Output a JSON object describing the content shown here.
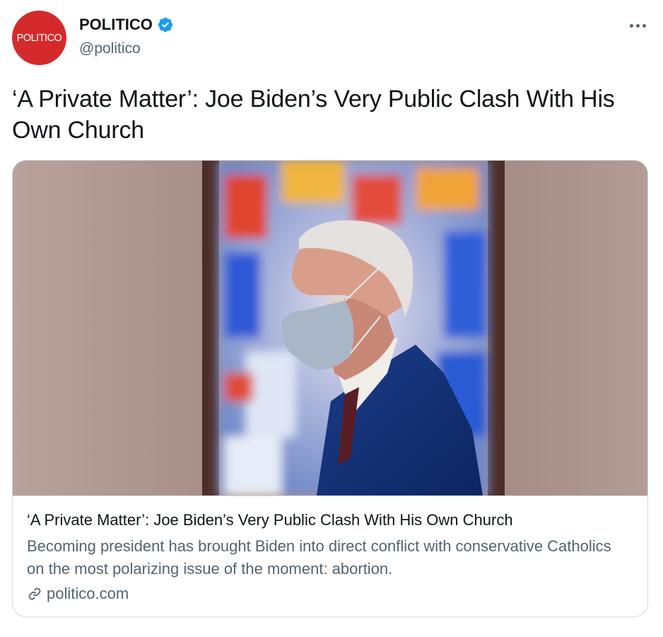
{
  "account": {
    "avatar_text": "POLITICO",
    "display_name": "POLITICO",
    "handle": "@politico",
    "verified": true,
    "brand_color": "#d52a2c",
    "verified_color": "#1d9bf0"
  },
  "tweet": {
    "text": "‘A Private Matter’: Joe Biden’s Very Public Clash With His Own Church"
  },
  "card": {
    "image_alt": "Joe Biden wearing a face mask in front of a stained glass window",
    "title": "‘A Private Matter’: Joe Biden’s Very Public Clash With His Own Church",
    "description": "Becoming president has brought Biden into direct conflict with conservative Catholics on the most polarizing issue of the moment: abortion.",
    "domain": "politico.com"
  },
  "icons": {
    "more": "more-options-icon",
    "verified": "verified-badge-icon",
    "link": "link-icon"
  }
}
